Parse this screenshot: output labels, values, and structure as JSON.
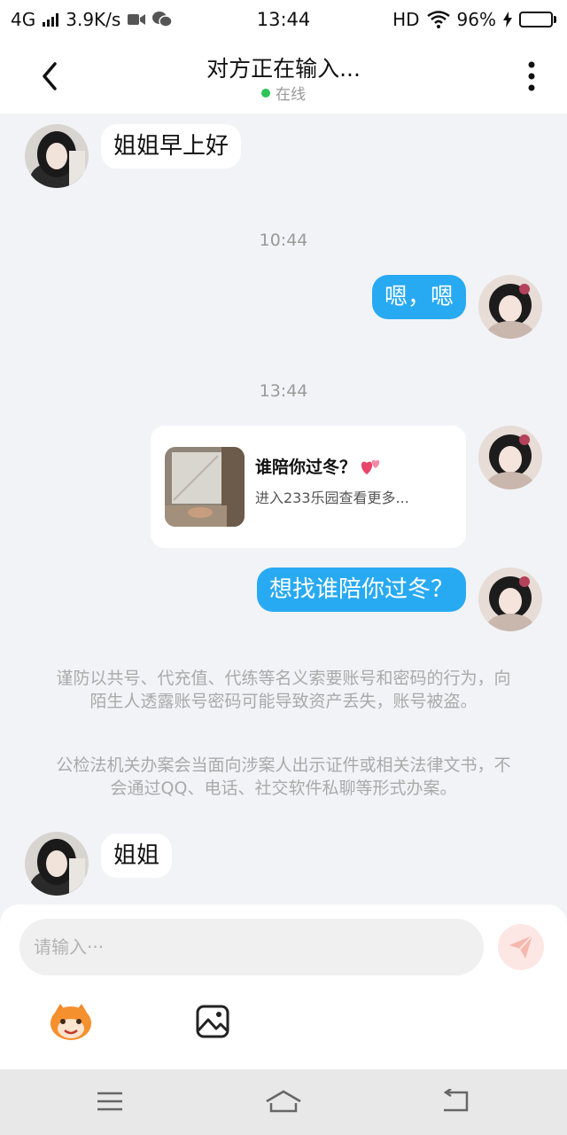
{
  "status_bar": {
    "network": "4G",
    "speed": "3.9K/s",
    "time": "13:44",
    "hd": "HD",
    "battery": "96%",
    "battery_level": 0.96
  },
  "header": {
    "title": "对方正在输入...",
    "status": "在线",
    "status_color": "#2ec45a"
  },
  "messages": {
    "m1": "姐姐早上好",
    "time1": "10:44",
    "m2": "嗯，嗯",
    "time2": "13:44",
    "card_title": "谁陪你过冬？",
    "card_subtitle": "进入233乐园查看更多...",
    "m3": "想找谁陪你过冬？",
    "notice1": "谨防以共号、代充值、代练等名义索要账号和密码的行为，向陌生人透露账号密码可能导致资产丢失，账号被盗。",
    "notice2": "公检法机关办案会当面向涉案人出示证件或相关法律文书，不会通过QQ、电话、社交软件私聊等形式办案。",
    "m4": "姐姐"
  },
  "input": {
    "placeholder": "请输入···"
  },
  "colors": {
    "outgoing_bubble": "#28aaf2",
    "incoming_bubble": "#ffffff",
    "background": "#f2f3f7"
  },
  "icons": [
    "back-arrow-icon",
    "more-vertical-icon",
    "send-icon",
    "mascot-emoji-icon",
    "image-icon",
    "menu-icon",
    "home-icon",
    "back-icon"
  ]
}
